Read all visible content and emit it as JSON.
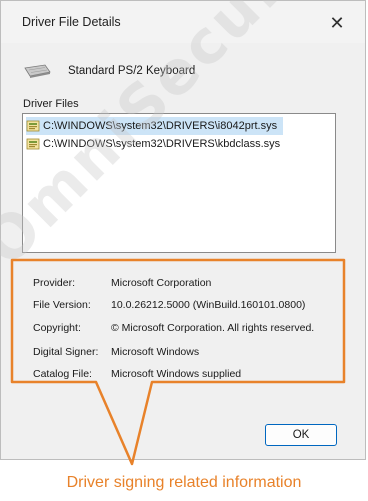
{
  "dialog": {
    "title": "Driver File Details",
    "close_glyph": "✕",
    "device_name": "Standard PS/2 Keyboard",
    "device_icon": "keyboard-icon",
    "files_label": "Driver Files",
    "files": [
      {
        "path": "C:\\WINDOWS\\system32\\DRIVERS\\i8042prt.sys",
        "selected": true
      },
      {
        "path": "C:\\WINDOWS\\system32\\DRIVERS\\kbdclass.sys",
        "selected": false
      }
    ],
    "details": {
      "provider_label": "Provider:",
      "provider": "Microsoft Corporation",
      "version_label": "File Version:",
      "version": "10.0.26212.5000 (WinBuild.160101.0800)",
      "copyright_label": "Copyright:",
      "copyright": "© Microsoft Corporation. All rights reserved.",
      "signer_label": "Digital Signer:",
      "signer": "Microsoft Windows",
      "catalog_label": "Catalog File:",
      "catalog": "Microsoft Windows supplied"
    },
    "ok_label": "OK"
  },
  "annotation": {
    "caption": "Driver signing related information",
    "color": "#e8822a"
  },
  "watermark": {
    "text": "OmniSecu.com"
  },
  "colors": {
    "selection": "#cce4f7",
    "accent": "#0067c0"
  }
}
